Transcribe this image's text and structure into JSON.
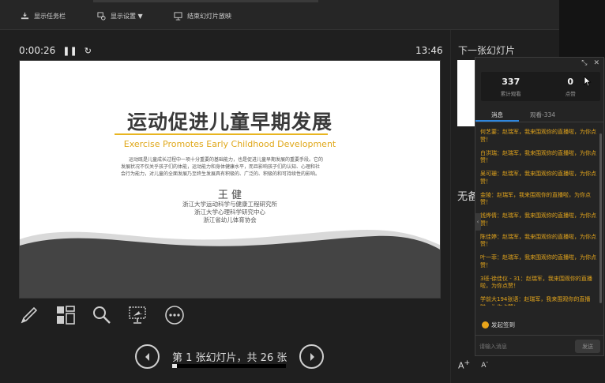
{
  "toolbar": {
    "show_taskbar": "显示任务栏",
    "display_settings": "显示设置 ▼",
    "end_show": "结束幻灯片放映"
  },
  "timer": {
    "elapsed": "0:00:26",
    "pause_icon": "pause-icon",
    "reset_icon": "reset-icon",
    "clock": "13:46"
  },
  "slide": {
    "title": "运动促进儿童早期发展",
    "subtitle": "Exercise Promotes Early Childhood Development",
    "body": "运动既是儿童成长过程中一项十分重要的基础能力，也是促进儿童早期发展的重要手段。它的发展状况不仅关乎孩子们的体能，运动能力和身体健康水平，而且影响孩子们的认知、心理和社会行为能力，对儿童的全面发展乃至终生发展具有积极的、广泛的、积极的和可持续性的影响。",
    "author": "王 健",
    "affiliations": [
      "浙江大学运动科学与健康工程研究所",
      "浙江大学心理科学研究中心",
      "浙江省幼儿体育协会"
    ]
  },
  "tools": [
    "pen-icon",
    "slides-grid-icon",
    "magnifier-icon",
    "screen-pointer-icon",
    "more-options-icon"
  ],
  "navigator": {
    "label": "第 1 张幻灯片，共 26 张",
    "current": 1,
    "total": 26
  },
  "right_pane": {
    "next_slide_label": "下一张幻灯片",
    "notes_label": "无备",
    "font_increase": "A",
    "font_decrease": "A"
  },
  "live": {
    "viewers_total": "337",
    "viewers_caption": "累计观看",
    "likes": "0",
    "likes_caption": "点赞",
    "tab_messages": "消息",
    "tab_viewers": "观看-334",
    "messages": [
      "何艺要：赵瑞军，我来围观你的直播啦，为你点赞！",
      "白洪瑞：赵瑞军，我来围观你的直播啦，为你点赞！",
      "吴可珊：赵瑞军，我来围观你的直播啦，为你点赞！",
      "金陵：赵瑞军，我来围观你的直播啦，为你点赞！",
      "钱烨倩：赵瑞军，我来围观你的直播啦，为你点赞！",
      "陈佳婷：赵瑞军，我来围观你的直播啦，为你点赞！",
      "叶一菲：赵瑞军，我来围观你的直播啦，为你点赞！",
      "3班-徐佳仪 - 31：赵瑞军，我来围观你的直播啦，为你点赞！",
      "学前大194张语：赵瑞军，我来围观你的直播啦，为你点赞！"
    ],
    "checkin": "发起签到",
    "input_placeholder": "请输入消息",
    "send": "发送"
  },
  "colors": {
    "accent": "#2e86de",
    "message_text": "#e3a51c",
    "slide_title_underline": "#e8b520"
  }
}
